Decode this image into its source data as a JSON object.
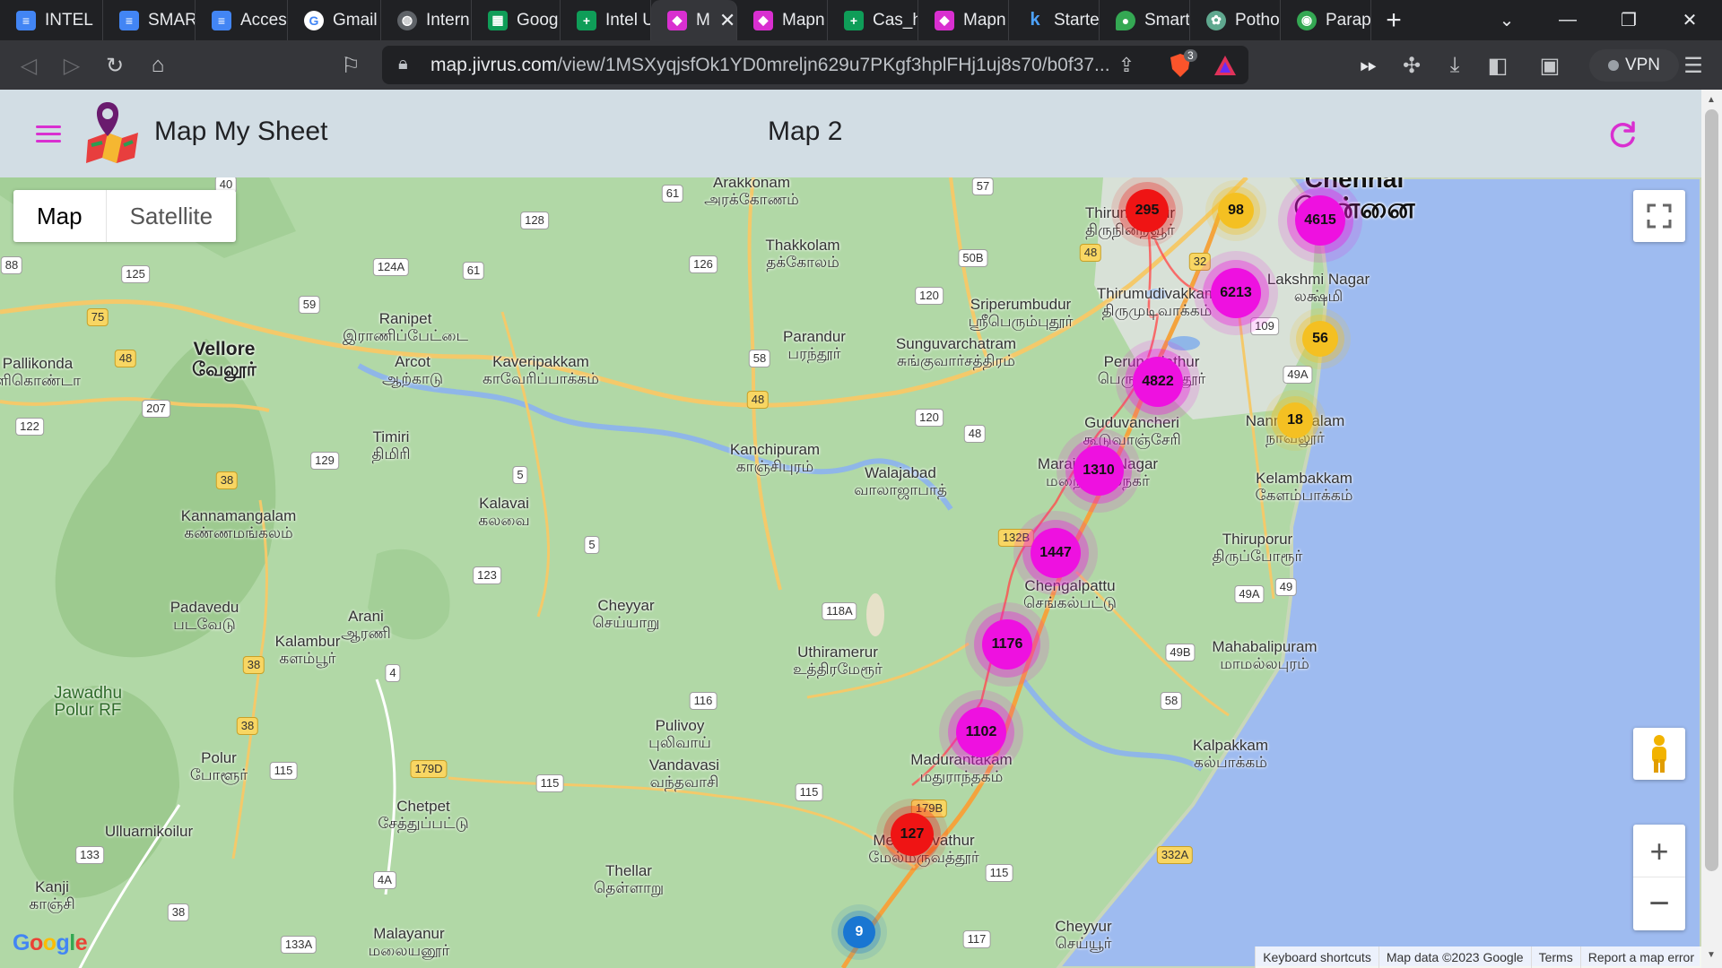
{
  "browser": {
    "tabs": [
      {
        "label": "INTEL",
        "icon": "docs-icon",
        "color": "#4285f4"
      },
      {
        "label": "SMAR",
        "icon": "docs-icon",
        "color": "#4285f4"
      },
      {
        "label": "Acces",
        "icon": "docs-icon",
        "color": "#4285f4"
      },
      {
        "label": "Gmail",
        "icon": "google-icon",
        "color": "#ffffff"
      },
      {
        "label": "Intern",
        "icon": "globe-icon",
        "color": "#9aa0a6"
      },
      {
        "label": "Goog",
        "icon": "sheets-icon",
        "color": "#0f9d58"
      },
      {
        "label": "Intel U",
        "icon": "sheets-plus-icon",
        "color": "#0f9d58"
      },
      {
        "label": "M",
        "icon": "mapmysheet-icon",
        "color": "#d92fd0",
        "active": true
      },
      {
        "label": "Mapn",
        "icon": "mapmysheet-icon",
        "color": "#d92fd0"
      },
      {
        "label": "Cas_h",
        "icon": "sheets-plus-icon",
        "color": "#0f9d58"
      },
      {
        "label": "Mapn",
        "icon": "mapmysheet-icon",
        "color": "#d92fd0"
      },
      {
        "label": "Starte",
        "icon": "k-icon",
        "color": "#1a73e8"
      },
      {
        "label": "Smart",
        "icon": "pin-icon",
        "color": "#34a853"
      },
      {
        "label": "Potho",
        "icon": "openai-icon",
        "color": "#5fa88f"
      },
      {
        "label": "Parap",
        "icon": "android-icon",
        "color": "#34a853"
      }
    ],
    "new_tab": "+",
    "url_host": "map.jivrus.com",
    "url_path": "/view/1MSXyqjsfOk1YD0mreljn629u7PKgf3hplFHj1uj8s70/b0f37...",
    "brave_badge": "3",
    "vpn_label": "VPN"
  },
  "app": {
    "title": "Map My Sheet",
    "map_name": "Map 2",
    "accent": "#d92fd0"
  },
  "map": {
    "type_buttons": {
      "map": "Map",
      "satellite": "Satellite"
    },
    "google": "Google",
    "attribution": [
      "Keyboard shortcuts",
      "Map data ©2023 Google",
      "Terms",
      "Report a map error"
    ],
    "clusters": [
      {
        "count": "295",
        "color": "red"
      },
      {
        "count": "98",
        "color": "yellow"
      },
      {
        "count": "4615",
        "color": "magenta"
      },
      {
        "count": "6213",
        "color": "magenta"
      },
      {
        "count": "56",
        "color": "yellow"
      },
      {
        "count": "4822",
        "color": "magenta"
      },
      {
        "count": "18",
        "color": "yellow"
      },
      {
        "count": "1310",
        "color": "magenta"
      },
      {
        "count": "1447",
        "color": "magenta"
      },
      {
        "count": "1176",
        "color": "magenta"
      },
      {
        "count": "1102",
        "color": "magenta"
      },
      {
        "count": "127",
        "color": "red"
      },
      {
        "count": "9",
        "color": "blue"
      }
    ],
    "places": [
      {
        "name": "Arakkonam",
        "tamil": "அரக்கோணம்"
      },
      {
        "name": "Thakkolam",
        "tamil": "தக்கோலம்"
      },
      {
        "name": "Chennai",
        "tamil": "சென்னை"
      },
      {
        "name": "Thiruninravur",
        "tamil": "திருநின்றவூர்"
      },
      {
        "name": "Sriperumbudur",
        "tamil": "ஸ்ரீபெரும்புதூர்"
      },
      {
        "name": "Thirumudivakkam",
        "tamil": "திருமுடிவாக்கம்"
      },
      {
        "name": "Lakshmi Nagar",
        "tamil": "லக்ஷ்மி"
      },
      {
        "name": "Vellore",
        "tamil": "வேலூர்"
      },
      {
        "name": "Ranipet",
        "tamil": "இராணிப்பேட்டை"
      },
      {
        "name": "Parandur",
        "tamil": "பரந்தூர்"
      },
      {
        "name": "Sunguvarchatram",
        "tamil": "சுங்குவார்சத்திரம்"
      },
      {
        "name": "Pallikonda",
        "tamil": "ளிகொண்டா"
      },
      {
        "name": "Arcot",
        "tamil": "ஆற்காடு"
      },
      {
        "name": "Kaveripakkam",
        "tamil": "காவேரிப்பாக்கம்"
      },
      {
        "name": "Perungalathur",
        "tamil": "பெருங்களத்தூர்"
      },
      {
        "name": "Nanmangalam",
        "tamil": "நாவலூர்"
      },
      {
        "name": "Guduvancheri",
        "tamil": "கூடுவாஞ்சேரி"
      },
      {
        "name": "Timiri",
        "tamil": "திமிரி"
      },
      {
        "name": "Kanchipuram",
        "tamil": "காஞ்சிபுரம்"
      },
      {
        "name": "Walajabad",
        "tamil": "வாலாஜாபாத்"
      },
      {
        "name": "Maraimalai Nagar",
        "tamil": "மறைமலைநகர்"
      },
      {
        "name": "Kelambakkam",
        "tamil": "கேளம்பாக்கம்"
      },
      {
        "name": "Kalavai",
        "tamil": "கலவை"
      },
      {
        "name": "Kannamangalam",
        "tamil": "கண்ணமங்கலம்"
      },
      {
        "name": "Thiruporur",
        "tamil": "திருப்போரூர்"
      },
      {
        "name": "Chengalpattu",
        "tamil": "செங்கல்பட்டு"
      },
      {
        "name": "Cheyyar",
        "tamil": "செய்யாறு"
      },
      {
        "name": "Padavedu",
        "tamil": "படவேடு"
      },
      {
        "name": "Arani",
        "tamil": "ஆரணி"
      },
      {
        "name": "Kalambur",
        "tamil": "களம்பூர்"
      },
      {
        "name": "Uthiramerur",
        "tamil": "உத்திரமேரூர்"
      },
      {
        "name": "Mahabalipuram",
        "tamil": "மாமல்லபுரம்"
      },
      {
        "name": "Jawadhu Polur RF",
        "tamil": ""
      },
      {
        "name": "Pulivoy",
        "tamil": "புலிவாய்"
      },
      {
        "name": "Vandavasi",
        "tamil": "வந்தவாசி"
      },
      {
        "name": "Madurantakam",
        "tamil": "மதுராந்தகம்"
      },
      {
        "name": "Kalpakkam",
        "tamil": "கல்பாக்கம்"
      },
      {
        "name": "Polur",
        "tamil": "போளூர்"
      },
      {
        "name": "Chetpet",
        "tamil": "சேத்துப்பட்டு"
      },
      {
        "name": "Ulluarnikoilur",
        "tamil": ""
      },
      {
        "name": "Melmaruvathur",
        "tamil": "மேல்மருவத்தூர்"
      },
      {
        "name": "Kanji",
        "tamil": "காஞ்சி"
      },
      {
        "name": "Thellar",
        "tamil": "தெள்ளாறு"
      },
      {
        "name": "Cheyyur",
        "tamil": "செய்யூர்"
      },
      {
        "name": "Malayanur",
        "tamil": "மலையனூர்"
      }
    ],
    "highways": [
      "40",
      "61",
      "128",
      "57",
      "88",
      "125",
      "124A",
      "61",
      "126",
      "50B",
      "48",
      "32",
      "75",
      "59",
      "120",
      "109",
      "48",
      "58",
      "49A",
      "207",
      "48",
      "120",
      "48",
      "122",
      "129",
      "5",
      "38",
      "132B",
      "5",
      "123",
      "49A",
      "49",
      "118A",
      "49B",
      "38",
      "4",
      "116",
      "58",
      "38",
      "179D",
      "115",
      "115",
      "115",
      "179B",
      "133",
      "4A",
      "38",
      "332A",
      "115",
      "133A",
      "117"
    ]
  }
}
